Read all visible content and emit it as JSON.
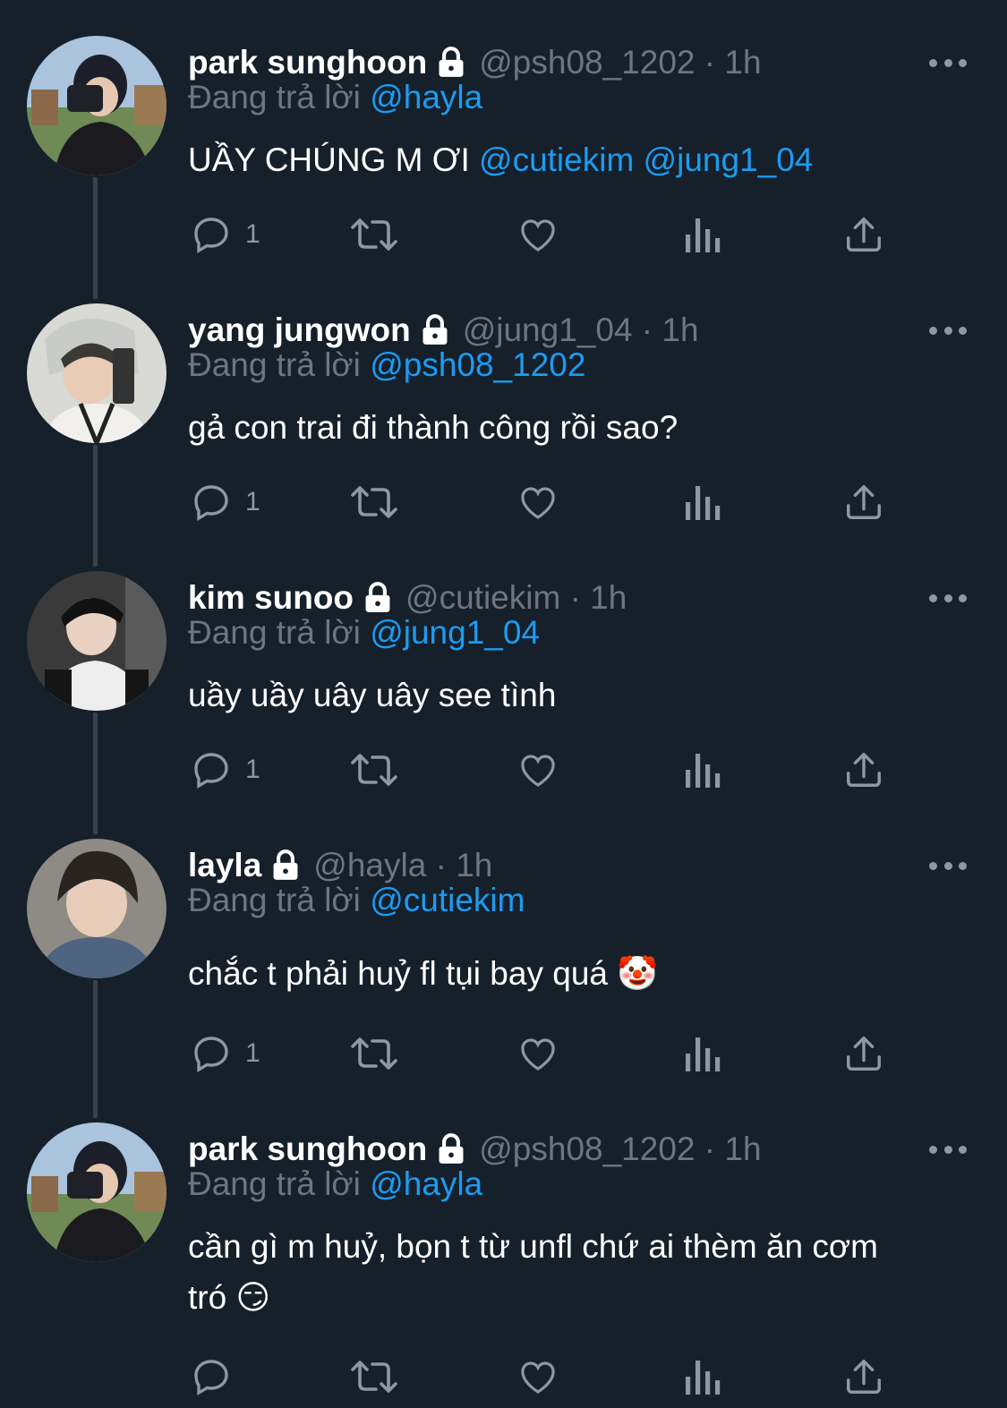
{
  "colors": {
    "background": "#15202b",
    "mention": "#1d9bf0",
    "secondary_text": "#6e767d",
    "icon": "#8b98a5",
    "thread_line": "#38444d"
  },
  "tweets": [
    {
      "name": "park sunghoon",
      "handle": "@psh08_1202 · 1h",
      "reply_prefix": "Đang trả lời ",
      "reply_to": "@hayla",
      "text_parts": [
        "UẦY CHÚNG M ƠI ",
        "@cutiekim",
        " ",
        "@jung1_04"
      ],
      "text_line2": "",
      "reply_count": "1",
      "lock_icon": "lock-icon",
      "more_icon": "more-dots-icon"
    },
    {
      "name": "yang jungwon",
      "handle": "@jung1_04 · 1h",
      "reply_prefix": "Đang trả lời ",
      "reply_to": "@psh08_1202",
      "text_parts": [
        "gả con trai đi thành công rồi sao?",
        "",
        "",
        ""
      ],
      "text_line2": "",
      "reply_count": "1"
    },
    {
      "name": "kim sunoo",
      "handle": "@cutiekim · 1h",
      "reply_prefix": "Đang trả lời ",
      "reply_to": "@jung1_04",
      "text_parts": [
        "uầy uầy uây uây see tình",
        "",
        "",
        ""
      ],
      "text_line2": "",
      "reply_count": "1"
    },
    {
      "name": "layla",
      "handle": "@hayla · 1h",
      "reply_prefix": "Đang trả lời ",
      "reply_to": "@cutiekim",
      "text_parts": [
        "chắc t phải huỷ fl tụi bay quá 🤡",
        "",
        "",
        ""
      ],
      "text_line2": "",
      "reply_count": "1"
    },
    {
      "name": "park sunghoon",
      "handle": "@psh08_1202 · 1h",
      "reply_prefix": "Đang trả lời ",
      "reply_to": "@hayla",
      "text_parts": [
        "cần gì m huỷ, bọn t từ unfl chứ ai thèm ăn cơm",
        "",
        "",
        ""
      ],
      "text_line2": "tró 😏",
      "reply_count": ""
    }
  ]
}
